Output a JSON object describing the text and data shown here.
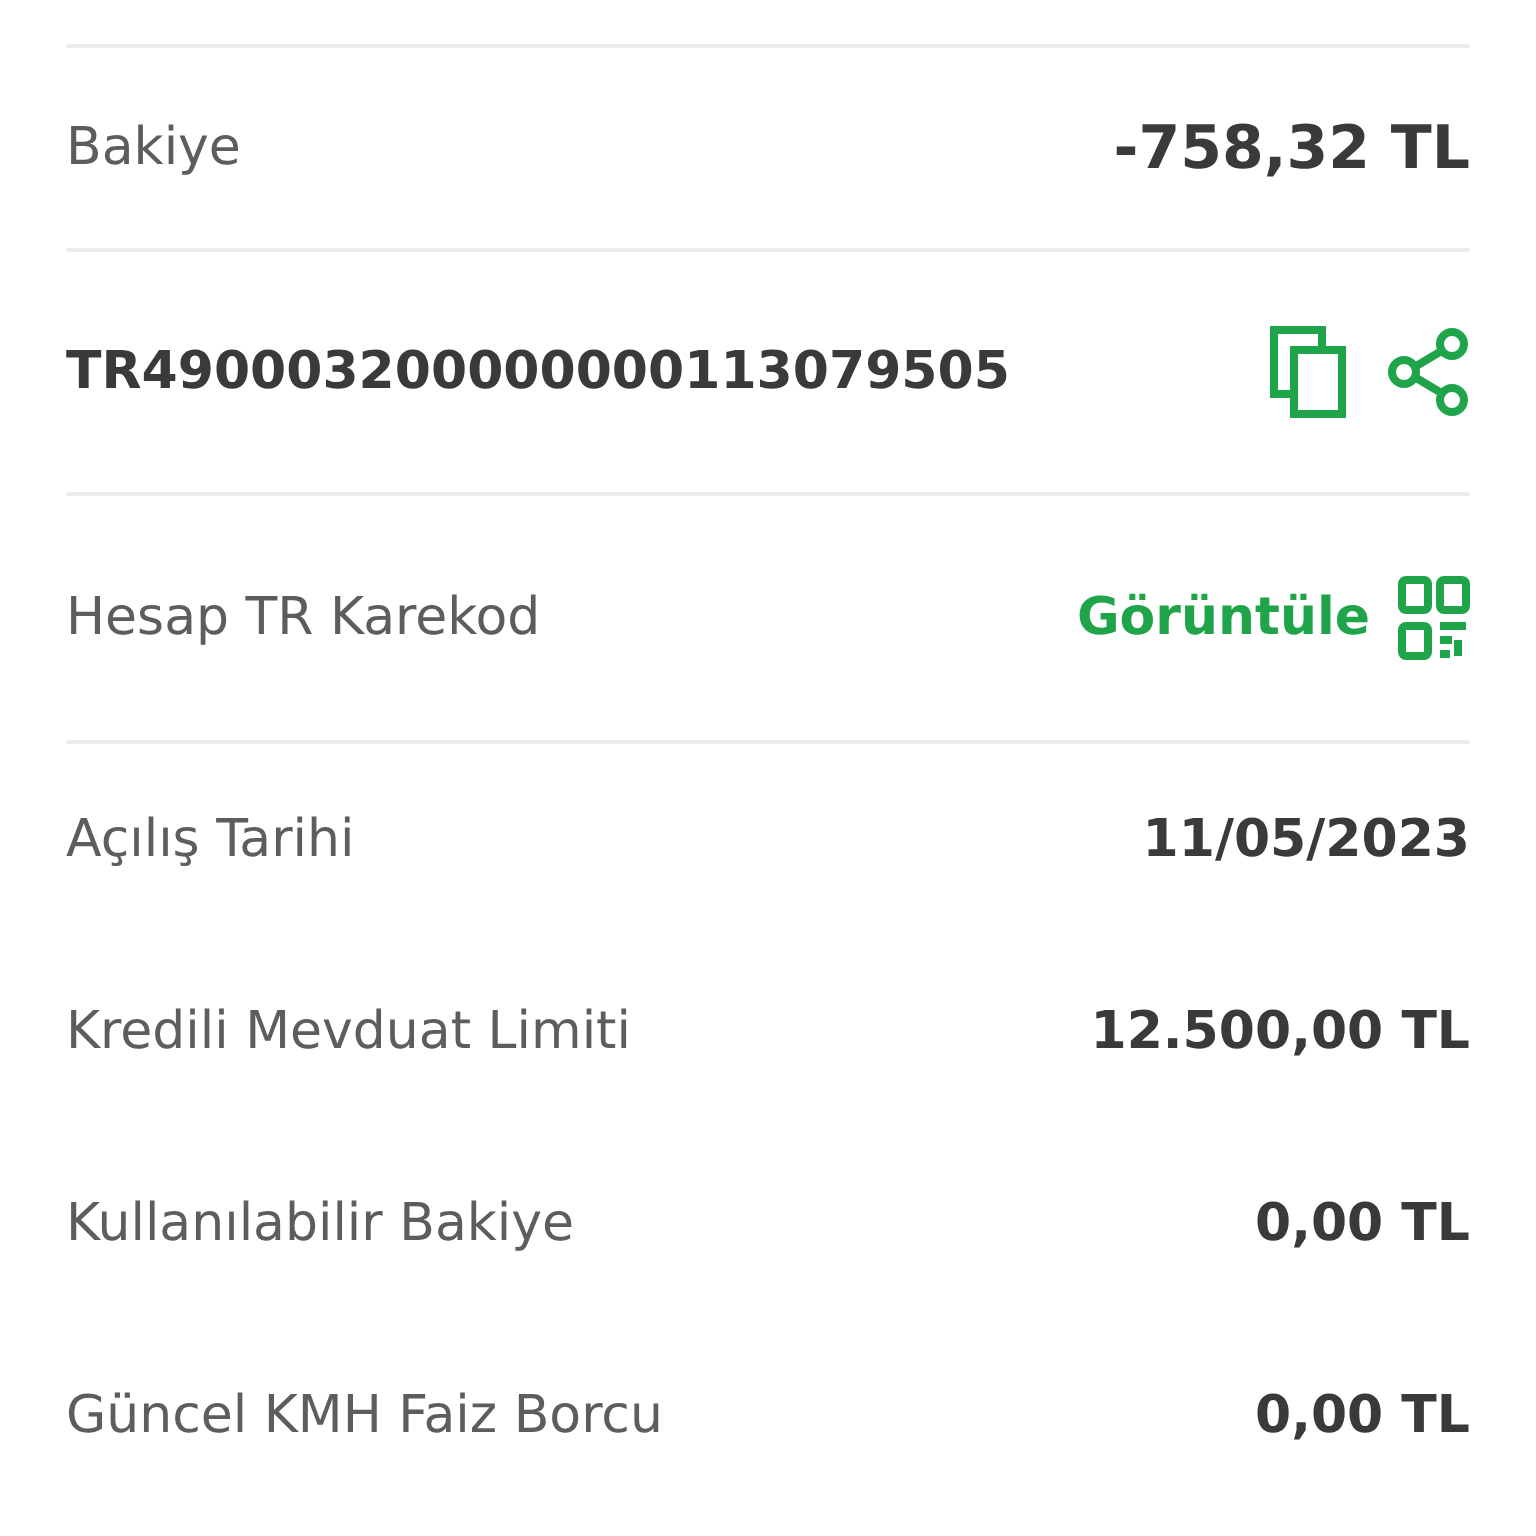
{
  "balance": {
    "label": "Bakiye",
    "value": "-758,32 TL"
  },
  "iban": {
    "value": "TR490003200000000113079505"
  },
  "qr": {
    "label": "Hesap TR Karekod",
    "action": "Görüntüle"
  },
  "details": [
    {
      "label": "Açılış Tarihi",
      "value": "11/05/2023"
    },
    {
      "label": "Kredili Mevduat Limiti",
      "value": "12.500,00 TL"
    },
    {
      "label": "Kullanılabilir Bakiye",
      "value": "0,00 TL"
    },
    {
      "label": "Güncel KMH Faiz Borcu",
      "value": "0,00 TL"
    }
  ]
}
